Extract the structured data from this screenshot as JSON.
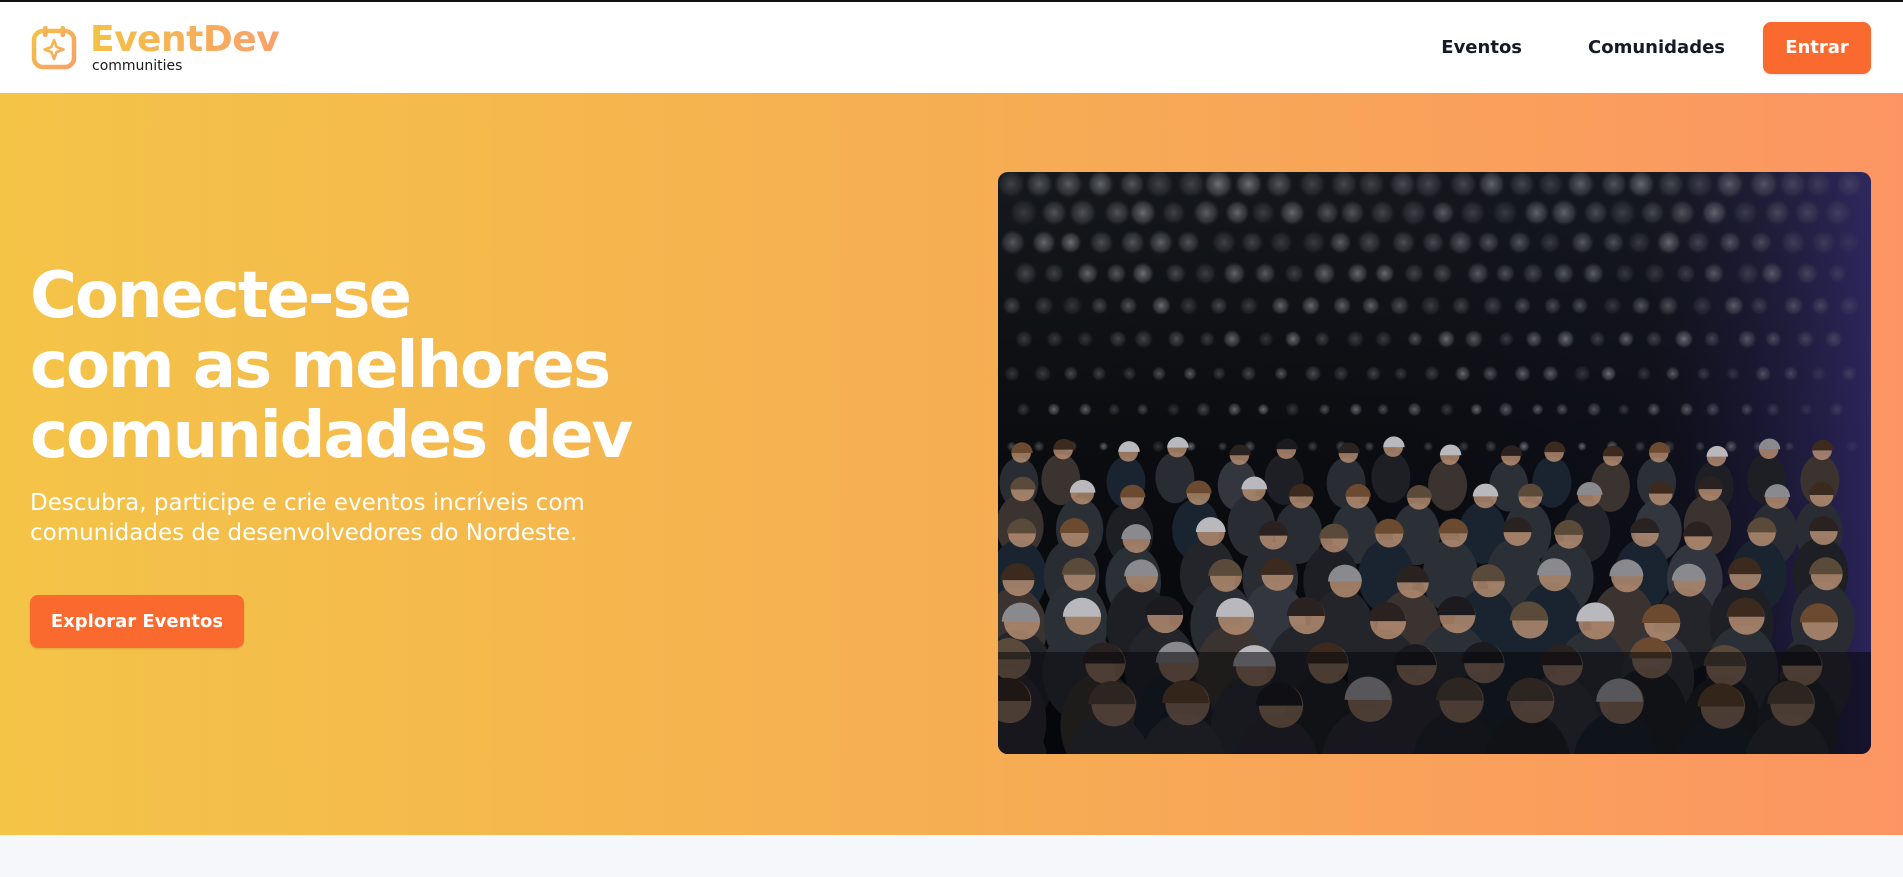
{
  "brand": {
    "name": "EventDev",
    "subtitle": "communities",
    "logo_icon": "calendar-sparkle-icon"
  },
  "nav": {
    "eventos_label": "Eventos",
    "comunidades_label": "Comunidades",
    "login_label": "Entrar"
  },
  "hero": {
    "title_lines": [
      "Conecte-se",
      "com as melhores",
      "comunidades dev"
    ],
    "description_line1": "Descubra, participe e crie eventos incríveis com",
    "description_line2": "comunidades de desenvolvedores do Nordeste.",
    "cta_label": "Explorar Eventos",
    "image": "conference-audience-photo"
  },
  "colors": {
    "accent": "#fa6a2f",
    "gradient_start": "#f4c447",
    "gradient_mid": "#f6ae52",
    "gradient_end": "#fc9563",
    "brand_text_start": "#f3c245",
    "brand_text_end": "#f9a06a"
  }
}
